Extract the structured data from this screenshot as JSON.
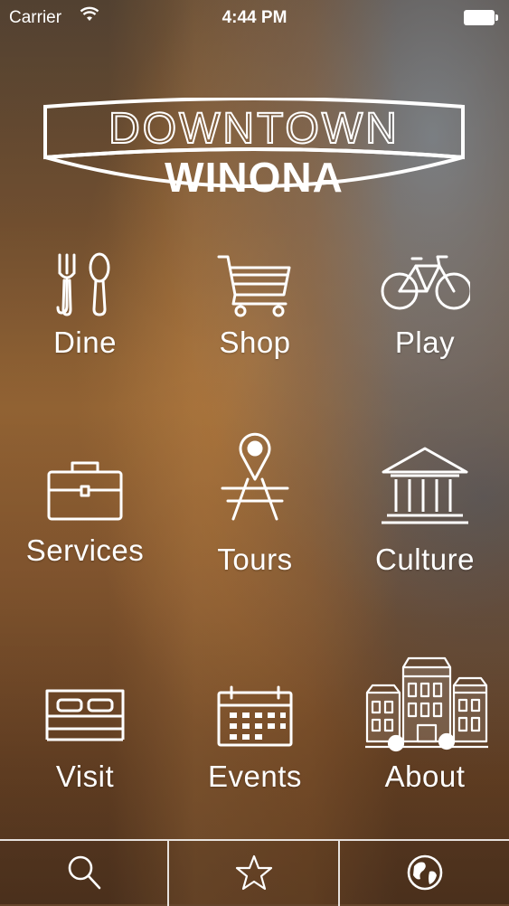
{
  "status_bar": {
    "carrier": "Carrier",
    "time": "4:44 PM"
  },
  "logo": {
    "line1": "DOWNTOWN",
    "line2": "WINONA"
  },
  "menu": [
    {
      "label": "Dine",
      "icon": "fork-spoon-icon"
    },
    {
      "label": "Shop",
      "icon": "shopping-cart-icon"
    },
    {
      "label": "Play",
      "icon": "bicycle-icon"
    },
    {
      "label": "Services",
      "icon": "briefcase-icon"
    },
    {
      "label": "Tours",
      "icon": "map-pin-icon"
    },
    {
      "label": "Culture",
      "icon": "museum-icon"
    },
    {
      "label": "Visit",
      "icon": "bed-icon"
    },
    {
      "label": "Events",
      "icon": "calendar-icon"
    },
    {
      "label": "About",
      "icon": "storefronts-icon"
    }
  ],
  "tab_bar": [
    {
      "icon": "search-icon"
    },
    {
      "icon": "star-icon"
    },
    {
      "icon": "globe-icon"
    }
  ]
}
